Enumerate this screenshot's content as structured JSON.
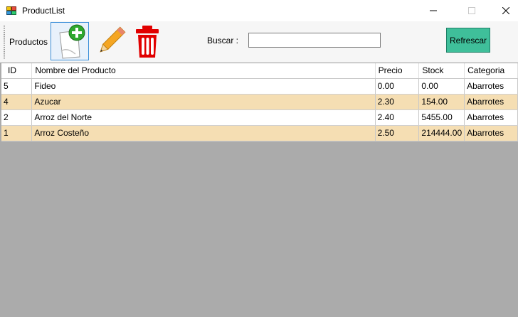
{
  "window": {
    "title": "ProductList",
    "app_icon": "app-window-icon",
    "controls": [
      "minimize-icon",
      "maximize-icon",
      "close-icon"
    ]
  },
  "toolbar": {
    "productos_label": "Productos",
    "new_icon": "new-document-icon",
    "edit_icon": "pencil-icon",
    "delete_icon": "trash-icon",
    "buscar_label": "Buscar :",
    "search_value": "",
    "refresh_label": "Refrescar",
    "refresh_color": "#3fbf9a"
  },
  "grid": {
    "columns": [
      "ID",
      "Nombre del Producto",
      "Precio",
      "Stock",
      "Categoria"
    ],
    "rows": [
      [
        "5",
        "Fideo",
        "0.00",
        "0.00",
        "Abarrotes"
      ],
      [
        "4",
        "Azucar",
        "2.30",
        "154.00",
        "Abarrotes"
      ],
      [
        "2",
        "Arroz del Norte",
        "2.40",
        "5455.00",
        "Abarrotes"
      ],
      [
        "1",
        "Arroz Costeño",
        "2.50",
        "214444.00",
        "Abarrotes"
      ]
    ],
    "alt_row_color": "#f5deb3",
    "background_color": "#ababab"
  }
}
